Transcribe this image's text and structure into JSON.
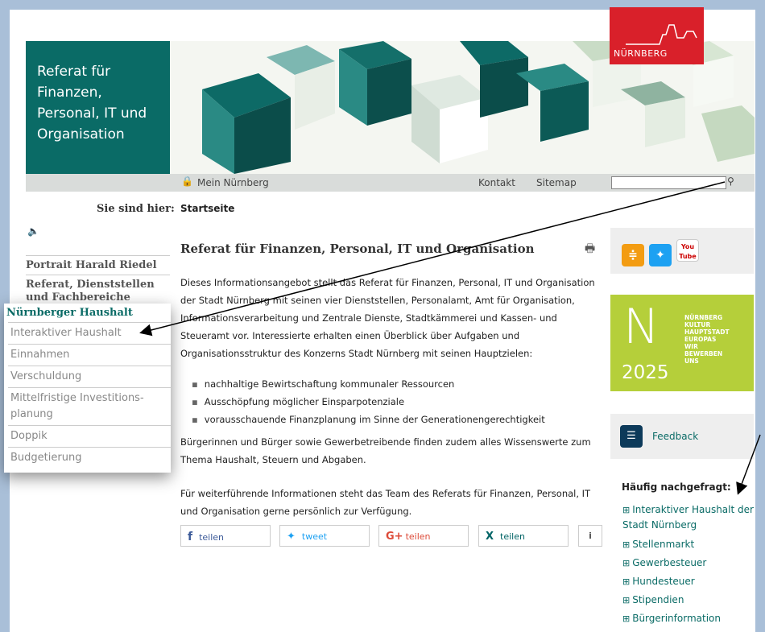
{
  "logo": {
    "text": "NÜRNBERG"
  },
  "header": {
    "title": "Referat für Finanzen, Personal, IT und Organisation"
  },
  "topbar": {
    "mein": "Mein Nürnberg",
    "kontakt": "Kontakt",
    "sitemap": "Sitemap"
  },
  "breadcrumb": {
    "label": "Sie sind hier:",
    "current": "Startseite"
  },
  "nav": {
    "item1": "Portrait Harald Riedel",
    "item2": "Referat, Dienststellen und Fachbereiche"
  },
  "popup": {
    "heading": "Nürnberger Haushalt",
    "items": [
      "Interaktiver Haushalt",
      "Einnahmen",
      "Verschuldung",
      "Mittelfristige Investitions-planung",
      "Doppik",
      "Budgetierung"
    ]
  },
  "main": {
    "title": "Referat für Finanzen, Personal, IT und Organisation",
    "p1": "Dieses Informationsangebot stellt das Referat für Finanzen, Personal, IT und Organisation der Stadt Nürnberg mit seinen vier Dienststellen, Personalamt, Amt für Organisation, Informationsverarbeitung und Zentrale Dienste, Stadtkämmerei und Kassen- und Steueramt vor. Interessierte erhalten einen Überblick über Aufgaben und Organisationsstruktur des Konzerns Stadt Nürnberg mit seinen Hauptzielen:",
    "bullets": [
      "nachhaltige Bewirtschaftung kommunaler Ressourcen",
      "Ausschöpfung möglicher Einsparpotenziale",
      "vorausschauende Finanzplanung im Sinne der Generationengerechtigkeit"
    ],
    "p2": "Bürgerinnen und Bürger sowie Gewerbetreibende finden zudem alles Wissenswerte zum Thema Haushalt, Steuern und Abgaben.",
    "p3": "Für weiterführende Informationen steht das Team des Referats für Finanzen, Personal, IT und Organisation gerne persönlich zur Verfügung."
  },
  "share": {
    "facebook": "teilen",
    "twitter": "tweet",
    "google": "teilen",
    "xing": "teilen",
    "info": "i"
  },
  "social": {
    "youtube_top": "You",
    "youtube_bottom": "Tube"
  },
  "campaign": {
    "year": "2025",
    "line1": "NÜRNBERG",
    "line2": "KULTUR",
    "line3": "HAUPTSTADT",
    "line4": "EUROPAS",
    "line5": "WIR",
    "line6": "BEWERBEN",
    "line7": "UNS"
  },
  "feedback": {
    "label": "Feedback"
  },
  "faq": {
    "heading": "Häufig nachgefragt:",
    "items": [
      "Interaktiver Haushalt der Stadt Nürnberg",
      "Stellenmarkt",
      "Gewerbesteuer",
      "Hundesteuer",
      "Stipendien",
      "Bürgerinformation"
    ]
  },
  "colors": {
    "teal": "#0a6b66",
    "red": "#d9202a",
    "green": "#b5cf3a"
  }
}
